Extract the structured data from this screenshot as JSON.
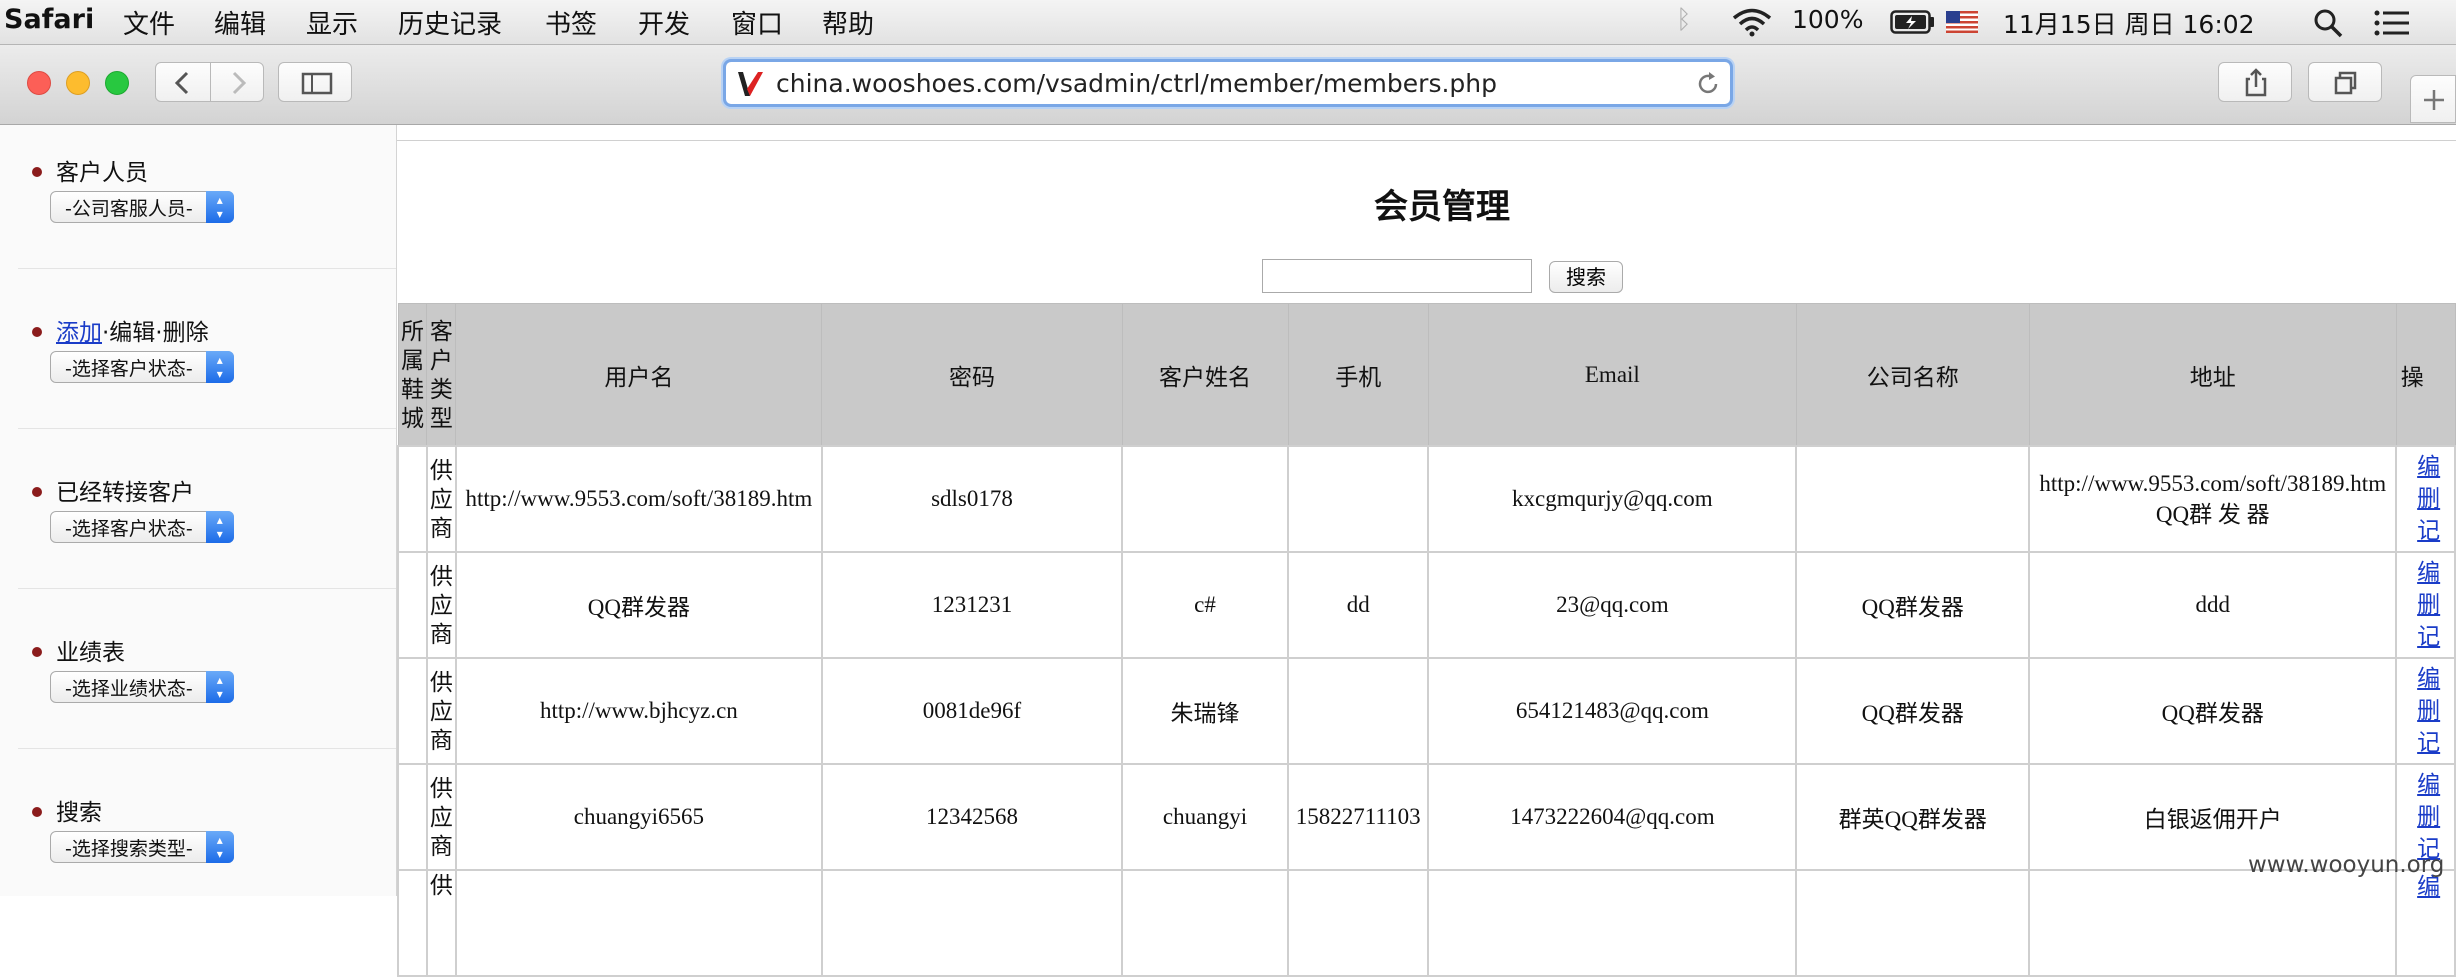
{
  "menubar": {
    "app": "Safari",
    "menus": [
      "文件",
      "编辑",
      "显示",
      "历史记录",
      "书签",
      "开发",
      "窗口",
      "帮助"
    ],
    "battery": "100%",
    "datetime": "11月15日 周日 16:02"
  },
  "browser": {
    "url": "china.wooshoes.com/vsadmin/ctrl/member/members.php"
  },
  "sidebar": {
    "sections": [
      {
        "title": "客户人员",
        "select": "-公司客服人员-"
      },
      {
        "title_link": "添加",
        "title_rest": "·编辑·删除",
        "select": "-选择客户状态-"
      },
      {
        "title": "已经转接客户",
        "select": "-选择客户状态-"
      },
      {
        "title": "业绩表",
        "select": "-选择业绩状态-"
      },
      {
        "title": "搜索",
        "select": "-选择搜索类型-"
      }
    ]
  },
  "main": {
    "title": "会员管理",
    "search_button": "搜索",
    "search_value": "",
    "columns": {
      "city": "所属鞋城",
      "type": "客户类型",
      "username": "用户名",
      "password": "密码",
      "name": "客户姓名",
      "phone": "手机",
      "email": "Email",
      "company": "公司名称",
      "address": "地址",
      "ops": "操"
    },
    "rows": [
      {
        "city": "",
        "type": "供应商",
        "username": "http://www.9553.com/soft/38189.htm",
        "password": "sdls0178",
        "name": "",
        "phone": "",
        "email": "kxcgmqurjy@qq.com",
        "company": "",
        "address_line1": "http://www.9553.com/soft/38189.htm",
        "address_line2": "QQ群 发 器",
        "op1": "编",
        "op2": "删",
        "op3": "记"
      },
      {
        "city": "",
        "type": "供应商",
        "username": "QQ群发器",
        "password": "1231231",
        "name": "c#",
        "phone": "dd",
        "email": "23@qq.com",
        "company": "QQ群发器",
        "address_line1": "ddd",
        "address_line2": "",
        "op1": "编",
        "op2": "删",
        "op3": "记"
      },
      {
        "city": "",
        "type": "供应商",
        "username": "http://www.bjhcyz.cn",
        "password": "0081de96f",
        "name": "朱瑞锋",
        "phone": "",
        "email": "654121483@qq.com",
        "company": "QQ群发器",
        "address_line1": "QQ群发器",
        "address_line2": "",
        "op1": "编",
        "op2": "删",
        "op3": "记"
      },
      {
        "city": "",
        "type": "供应商",
        "username": "chuangyi6565",
        "password": "12342568",
        "name": "chuangyi",
        "phone": "15822711103",
        "email": "1473222604@qq.com",
        "company": "群英QQ群发器",
        "address_line1": "白银返佣开户",
        "address_line2": "",
        "op1": "编",
        "op2": "删",
        "op3": "记"
      }
    ],
    "partial_row": {
      "type": "供",
      "op": "编"
    }
  },
  "watermark": "www.wooyun.org"
}
